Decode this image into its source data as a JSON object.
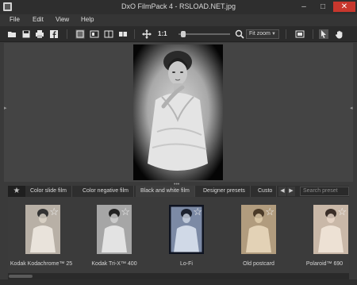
{
  "window": {
    "title": "DxO FilmPack 4 - RSLOAD.NET.jpg",
    "minimize_glyph": "–",
    "maximize_glyph": "□",
    "close_glyph": "✕"
  },
  "menu": [
    {
      "label": "File"
    },
    {
      "label": "Edit"
    },
    {
      "label": "View"
    },
    {
      "label": "Help"
    }
  ],
  "toolbar": {
    "zoom_label": "1:1",
    "zoom_select": "Fit zoom",
    "zoom_slider_level": 0.05,
    "icons": [
      "folder-icon",
      "save-icon",
      "print-icon",
      "facebook-icon",
      "single-view-icon",
      "before-after-icon",
      "split-view-icon",
      "compare-icon",
      "move-icon",
      "search-icon",
      "grid-icon",
      "pointer-icon",
      "hand-icon"
    ]
  },
  "browser": {
    "favorites_glyph": "★",
    "tabs": [
      {
        "label": "Color slide film"
      },
      {
        "label": "Color negative film"
      },
      {
        "label": "Black and white film"
      },
      {
        "label": "Designer presets"
      },
      {
        "label": "Custo"
      }
    ],
    "prev_glyph": "◀",
    "next_glyph": "▶",
    "search_placeholder": "Search preset"
  },
  "thumbnails": [
    {
      "label": "Kodak Kodachrome™ 25",
      "tint": "#b8b0a6"
    },
    {
      "label": "Kodak Tri-X™ 400",
      "tint": "#a6a6a6"
    },
    {
      "label": "Lo-Fi",
      "tint": "#7c8aa5"
    },
    {
      "label": "Old postcard",
      "tint": "#b19c7e"
    },
    {
      "label": "Polaroid™ 690",
      "tint": "#c9b8a8"
    }
  ],
  "colors": {
    "accent_close": "#c8372d",
    "background": "#3a3a3a"
  }
}
